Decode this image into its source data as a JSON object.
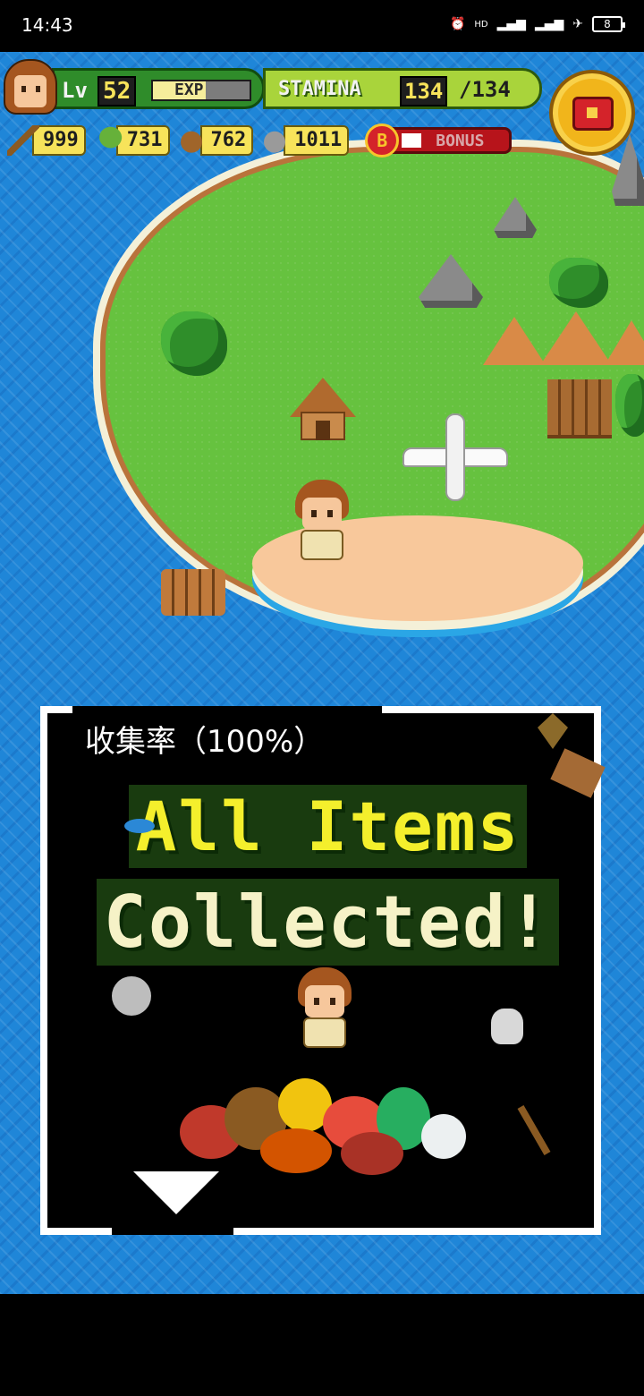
{
  "status_bar": {
    "time": "14:43",
    "net_label": "HD",
    "battery": "8"
  },
  "hud": {
    "level_label": "Lv",
    "level": "52",
    "exp_label": "EXP",
    "exp_fraction": 0.55,
    "stamina_label": "STAMINA",
    "stamina_current": "134",
    "stamina_max": "/134",
    "resources": [
      {
        "icon": "branch-icon",
        "value": "999"
      },
      {
        "icon": "leaf-icon",
        "value": "731"
      },
      {
        "icon": "nut-icon",
        "value": "762"
      },
      {
        "icon": "stone-icon",
        "value": "1011"
      }
    ],
    "bonus_badge": "B",
    "bonus_label": "BONUS",
    "bonus_fraction": 0.2
  },
  "modal": {
    "collection_rate": "收集率（100%）",
    "headline_1": "All Items",
    "headline_2": "Collected!"
  },
  "colors": {
    "sea": "#1f86d8",
    "grass": "#66c23f",
    "headline_yellow": "#f4ef2c"
  }
}
